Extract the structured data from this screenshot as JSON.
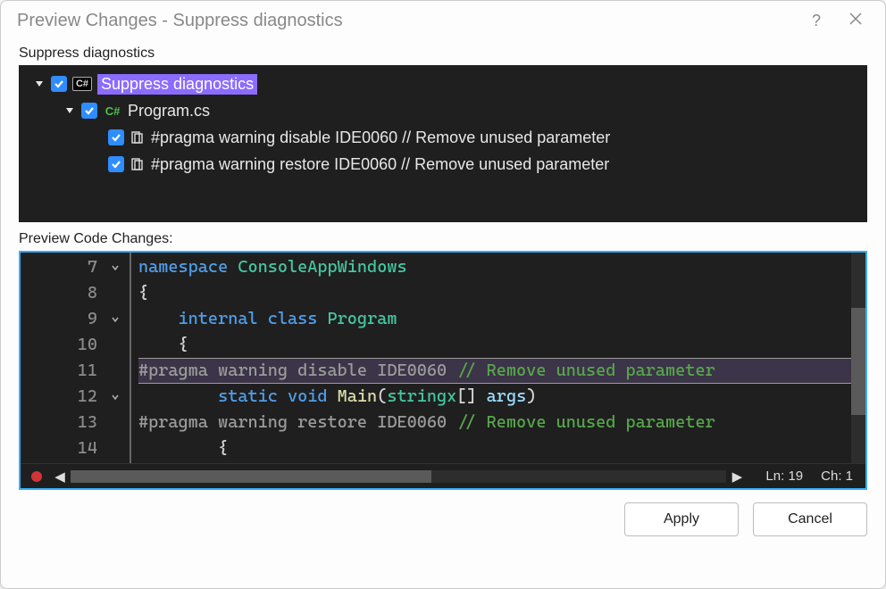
{
  "titlebar": {
    "title": "Preview Changes - Suppress diagnostics",
    "help_glyph": "?",
    "close_tooltip": "Close"
  },
  "tree": {
    "section_label": "Suppress diagnostics",
    "root": {
      "label": "Suppress diagnostics",
      "selected": true,
      "checked": true,
      "expanded": true
    },
    "file": {
      "label": "Program.cs",
      "checked": true,
      "expanded": true,
      "icon_text": "C#"
    },
    "changes": [
      {
        "label": "#pragma warning disable IDE0060 // Remove unused parameter",
        "checked": true
      },
      {
        "label": "#pragma warning restore IDE0060 // Remove unused parameter",
        "checked": true
      }
    ]
  },
  "code": {
    "section_label": "Preview Code Changes:",
    "line_numbers": [
      "7",
      "8",
      "9",
      "10",
      "11",
      "12",
      "13",
      "14"
    ],
    "fold_rows": [
      true,
      false,
      true,
      false,
      false,
      true,
      false,
      false
    ],
    "lines": [
      {
        "tokens": [
          [
            "key",
            "namespace "
          ],
          [
            "type",
            "ConsoleAppWindows"
          ]
        ]
      },
      {
        "tokens": [
          [
            "plain",
            "{"
          ]
        ]
      },
      {
        "tokens": [
          [
            "plain",
            "    "
          ],
          [
            "key",
            "internal class "
          ],
          [
            "type",
            "Program"
          ]
        ]
      },
      {
        "tokens": [
          [
            "plain",
            "    {"
          ]
        ]
      },
      {
        "highlight": true,
        "tokens": [
          [
            "pragma",
            "#pragma warning disable IDE0060 "
          ],
          [
            "comment",
            "// Remove unused parameter"
          ]
        ]
      },
      {
        "tokens": [
          [
            "plain",
            "        "
          ],
          [
            "key",
            "static void "
          ],
          [
            "method",
            "Main"
          ],
          [
            "plain",
            "("
          ],
          [
            "type",
            "stringx"
          ],
          [
            "plain",
            "[] "
          ],
          [
            "param",
            "args"
          ],
          [
            "plain",
            ")"
          ]
        ]
      },
      {
        "tokens": [
          [
            "plain",
            ""
          ],
          [
            "pragma",
            "#pragma warning restore IDE0060 "
          ],
          [
            "comment",
            "// Remove unused parameter"
          ]
        ]
      },
      {
        "tokens": [
          [
            "plain",
            "        {"
          ]
        ]
      }
    ],
    "status": {
      "line_label": "Ln: 19",
      "col_label": "Ch: 1"
    }
  },
  "buttons": {
    "apply": "Apply",
    "cancel": "Cancel"
  }
}
